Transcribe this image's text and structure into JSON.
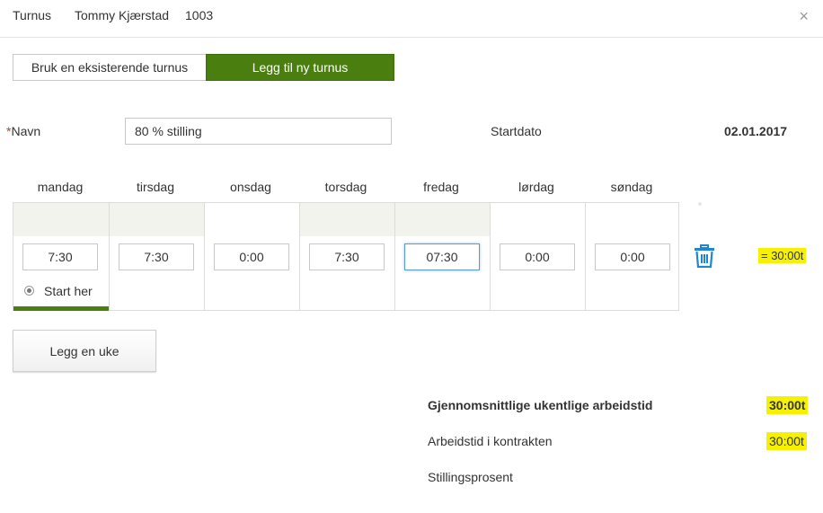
{
  "header": {
    "title": "Turnus",
    "employee": "Tommy Kjærstad",
    "employee_id": "1003",
    "close": "×"
  },
  "mode": {
    "existing_label": "Bruk en eksisterende turnus",
    "new_label": "Legg til ny turnus",
    "selected": "new"
  },
  "form": {
    "name_required": "*",
    "name_label": "Navn",
    "name_value": "80 % stilling",
    "start_label": "Startdato",
    "start_value": "02.01.2017"
  },
  "week": {
    "days": [
      {
        "day": "mandag",
        "hours": "7:30",
        "shaded": true
      },
      {
        "day": "tirsdag",
        "hours": "7:30",
        "shaded": true
      },
      {
        "day": "onsdag",
        "hours": "0:00",
        "shaded": false
      },
      {
        "day": "torsdag",
        "hours": "7:30",
        "shaded": true
      },
      {
        "day": "fredag",
        "hours": "07:30",
        "shaded": true
      },
      {
        "day": "lørdag",
        "hours": "0:00",
        "shaded": false
      },
      {
        "day": "søndag",
        "hours": "0:00",
        "shaded": false
      }
    ],
    "start_here_label": "Start her",
    "total": "= 30:00t",
    "delete_icon": "trash-icon"
  },
  "add_week_label": "Legg en uke",
  "summary": {
    "avg_label": "Gjennomsnittlige ukentlige arbeidstid",
    "avg_value": "30:00t",
    "contract_label": "Arbeidstid i kontrakten",
    "contract_value": "30:00t",
    "percent_label": "Stillingsprosent"
  },
  "colors": {
    "accent_green": "#4a7f0f",
    "highlight": "#f6f100",
    "trash_blue": "#1f86d6"
  }
}
